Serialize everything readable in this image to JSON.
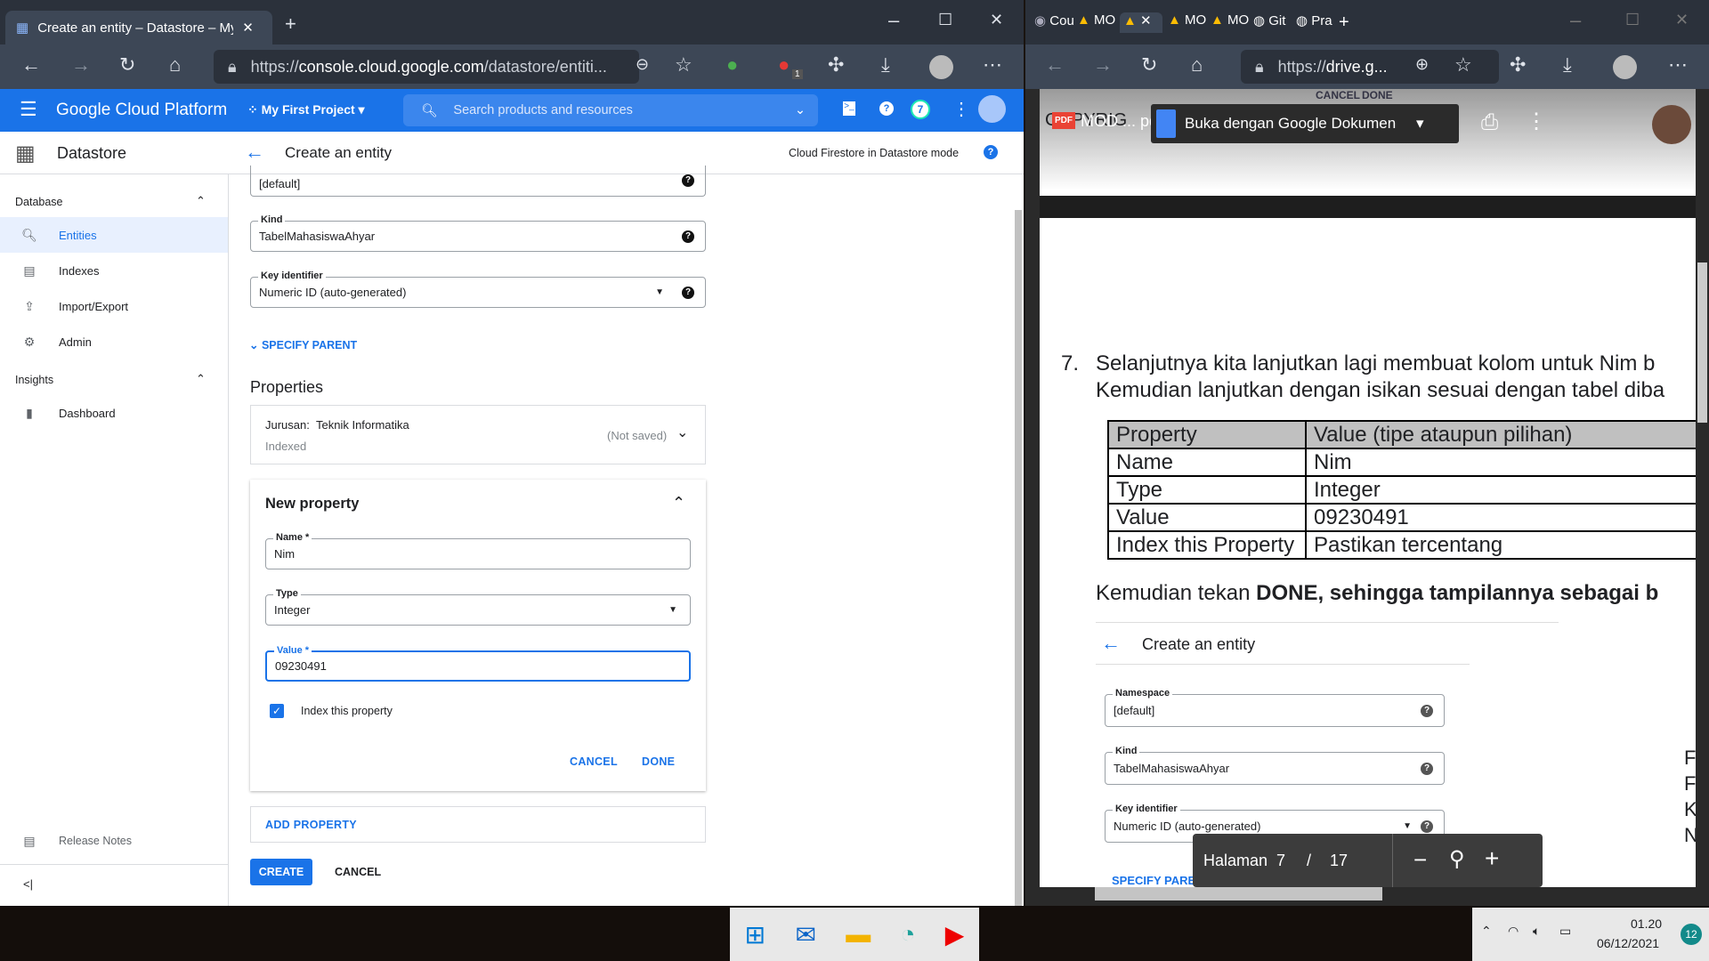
{
  "left_browser": {
    "tab_title": "Create an entity – Datastore – My",
    "url_prefix": "https://",
    "url_domain": "console.cloud.google.com",
    "url_rest": "/datastore/entiti...",
    "ext_badge": "1"
  },
  "gcp": {
    "product": "Google Cloud Platform",
    "project": "My First Project",
    "search_placeholder": "Search products and resources",
    "notif_count": "7",
    "service": "Datastore",
    "page_title": "Create an entity",
    "mode_label": "Cloud Firestore in Datastore mode"
  },
  "sidebar": {
    "database_label": "Database",
    "insights_label": "Insights",
    "items": [
      {
        "label": "Entities"
      },
      {
        "label": "Indexes"
      },
      {
        "label": "Import/Export"
      },
      {
        "label": "Admin"
      },
      {
        "label": "Dashboard"
      }
    ],
    "release_notes": "Release Notes",
    "collapse": "<|"
  },
  "form": {
    "namespace_value": "[default]",
    "kind_label": "Kind",
    "kind_value": "TabelMahasiswaAhyar",
    "key_label": "Key identifier",
    "key_value": "Numeric ID (auto-generated)",
    "specify_parent": "SPECIFY PARENT",
    "properties_heading": "Properties",
    "existing_property": {
      "name": "Jurusan:",
      "value": "Teknik Informatika",
      "indexed": "Indexed",
      "status": "(Not saved)"
    },
    "new_property": {
      "title": "New property",
      "name_label": "Name *",
      "name_value": "Nim",
      "type_label": "Type",
      "type_value": "Integer",
      "value_label": "Value *",
      "value_value": "09230491",
      "index_label": "Index this property",
      "index_checked": true,
      "cancel": "CANCEL",
      "done": "DONE"
    },
    "add_property": "ADD PROPERTY",
    "create": "CREATE",
    "cancel": "CANCEL"
  },
  "right_browser": {
    "tabs": [
      "Cou",
      "MO",
      "",
      "MO",
      "MO",
      "Git",
      "Pra"
    ],
    "url_prefix": "https://",
    "url_domain": "drive.g...",
    "pdf_name": "MOD ... pdf",
    "open_with": "Buka dengan Google Dokumen",
    "bg_cancel": "CANCEL",
    "bg_done": "DONE",
    "bg_text": "COPYRIG"
  },
  "pdf": {
    "step_number": "7.",
    "line1": "Selanjutnya kita lanjutkan lagi membuat kolom untuk Nim b",
    "line2": "Kemudian lanjutkan dengan isikan sesuai dengan tabel diba",
    "table_headers": [
      "Property",
      "Value (tipe ataupun pilihan)"
    ],
    "table_rows": [
      [
        "Name",
        "Nim"
      ],
      [
        "Type",
        "Integer"
      ],
      [
        "Value",
        "09230491"
      ],
      [
        "Index this Property",
        "Pastikan tercentang"
      ]
    ],
    "after_normal": "Kemudian tekan ",
    "after_bold": "DONE, sehingga tampilannya sebagai b",
    "shot_title": "Create an entity",
    "shot_namespace_label": "Namespace",
    "shot_namespace": "[default]",
    "shot_kind_label": "Kind",
    "shot_kind": "TabelMahasiswaAhyar",
    "shot_key_label": "Key identifier",
    "shot_key": "Numeric ID (auto-generated)",
    "shot_specify": "SPECIFY PARENT",
    "side_letters": [
      "F",
      "F",
      "K",
      "N"
    ],
    "page_label": "Halaman",
    "page_current": "7",
    "page_sep": "/",
    "page_total": "17"
  },
  "taskbar": {
    "time": "01.20",
    "date": "06/12/2021",
    "notif": "12"
  }
}
